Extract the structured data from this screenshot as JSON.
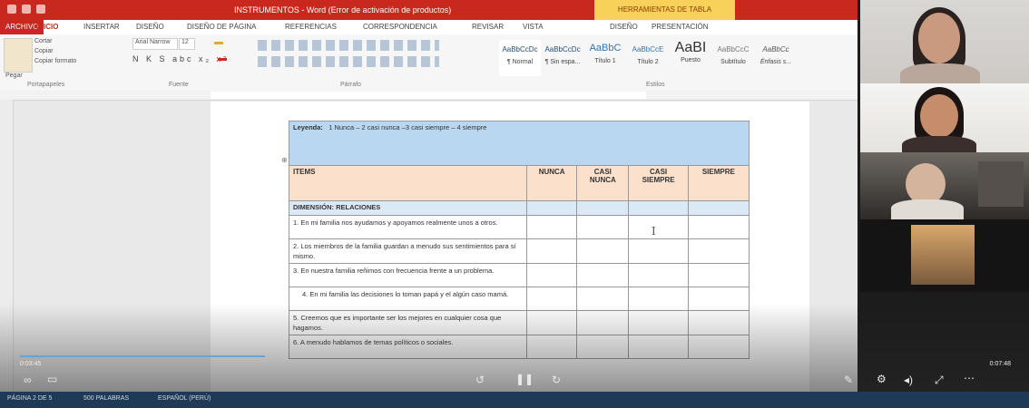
{
  "titlebar": {
    "doc_title": "INSTRUMENTOS - Word (Error de activación de productos)",
    "context_label": "HERRAMIENTAS DE TABLA"
  },
  "ribbon_tabs": [
    "ARCHIVO",
    "INICIO",
    "INSERTAR",
    "DISEÑO",
    "DISEÑO DE PÁGINA",
    "REFERENCIAS",
    "CORRESPONDENCIA",
    "REVISAR",
    "VISTA",
    "DISEÑO",
    "PRESENTACIÓN"
  ],
  "ribbon": {
    "paste_label": "Pegar",
    "cut_label": "Cortar",
    "copy_label": "Copiar",
    "format_painter_label": "Copiar formato",
    "font_name": "Arial Narrow",
    "font_size": "12",
    "groups": {
      "clipboard": "Portapapeles",
      "font": "Fuente",
      "paragraph": "Párrafo",
      "styles": "Estilos"
    },
    "styles": [
      {
        "sample": "AaBbCcDc",
        "name": "¶ Normal"
      },
      {
        "sample": "AaBbCcDc",
        "name": "¶ Sin espa..."
      },
      {
        "sample": "AaBbC",
        "name": "Título 1"
      },
      {
        "sample": "AaBbCcE",
        "name": "Título 2"
      },
      {
        "sample": "AaBI",
        "name": "Puesto"
      },
      {
        "sample": "AaBbCcC",
        "name": "Subtítulo"
      },
      {
        "sample": "AaBbCc",
        "name": "Énfasis s..."
      }
    ]
  },
  "document": {
    "legend_label": "Leyenda:",
    "legend_text": "1 Nunca – 2 casi nunca –3 casi siempre – 4 siempre",
    "columns": [
      "ITEMS",
      "NUNCA",
      "CASI NUNCA",
      "CASI SIEMPRE",
      "SIEMPRE"
    ],
    "dimension": "DIMENSIÓN: RELACIONES",
    "items": [
      "1. En mi familia nos ayudamos y apoyamos realmente unos a otros.",
      "2. Los miembros de la familia guardan a menudo sus sentimientos para sí mismo.",
      "3. En nuestra familia reñimos con frecuencia frente a un problema.",
      "4. En mi familia las decisiones lo toman papá y el algún caso mamá.",
      "5. Creemos que es importante ser los mejores en cualquier cosa que hagamos.",
      "6. A menudo hablamos de temas políticos o sociales."
    ]
  },
  "player": {
    "elapsed": "0:03:45",
    "total": "0:07:48"
  },
  "statusbar": {
    "page": "PÁGINA 2 DE 5",
    "words": "500 PALABRAS",
    "language": "ESPAÑOL (PERÚ)"
  }
}
